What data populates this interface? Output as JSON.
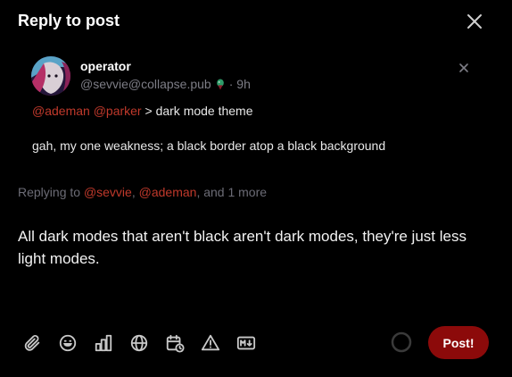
{
  "header": {
    "title": "Reply to post"
  },
  "quoted_post": {
    "display_name": "operator",
    "handle": "@sevvie@collapse.pub",
    "time": "· 9h",
    "mention_1": "@ademan",
    "mention_2": "@parker",
    "subject": "> dark mode theme",
    "body": "gah, my one weakness; a black border atop a black background"
  },
  "replying": {
    "prefix": "Replying to",
    "user_1": "@sevvie",
    "sep": ",",
    "user_2": "@ademan",
    "suffix": ", and 1 more"
  },
  "composer": {
    "text": "All dark modes that aren't black aren't dark modes, they're just less light modes."
  },
  "toolbar": {
    "icons": [
      "paperclip-icon",
      "emoji-icon",
      "poll-icon",
      "globe-icon",
      "schedule-icon",
      "warning-icon",
      "markdown-icon"
    ],
    "post_label": "Post!"
  },
  "colors": {
    "accent": "#8c0a0a",
    "mention": "#c0392b",
    "muted": "#6c6c76"
  }
}
